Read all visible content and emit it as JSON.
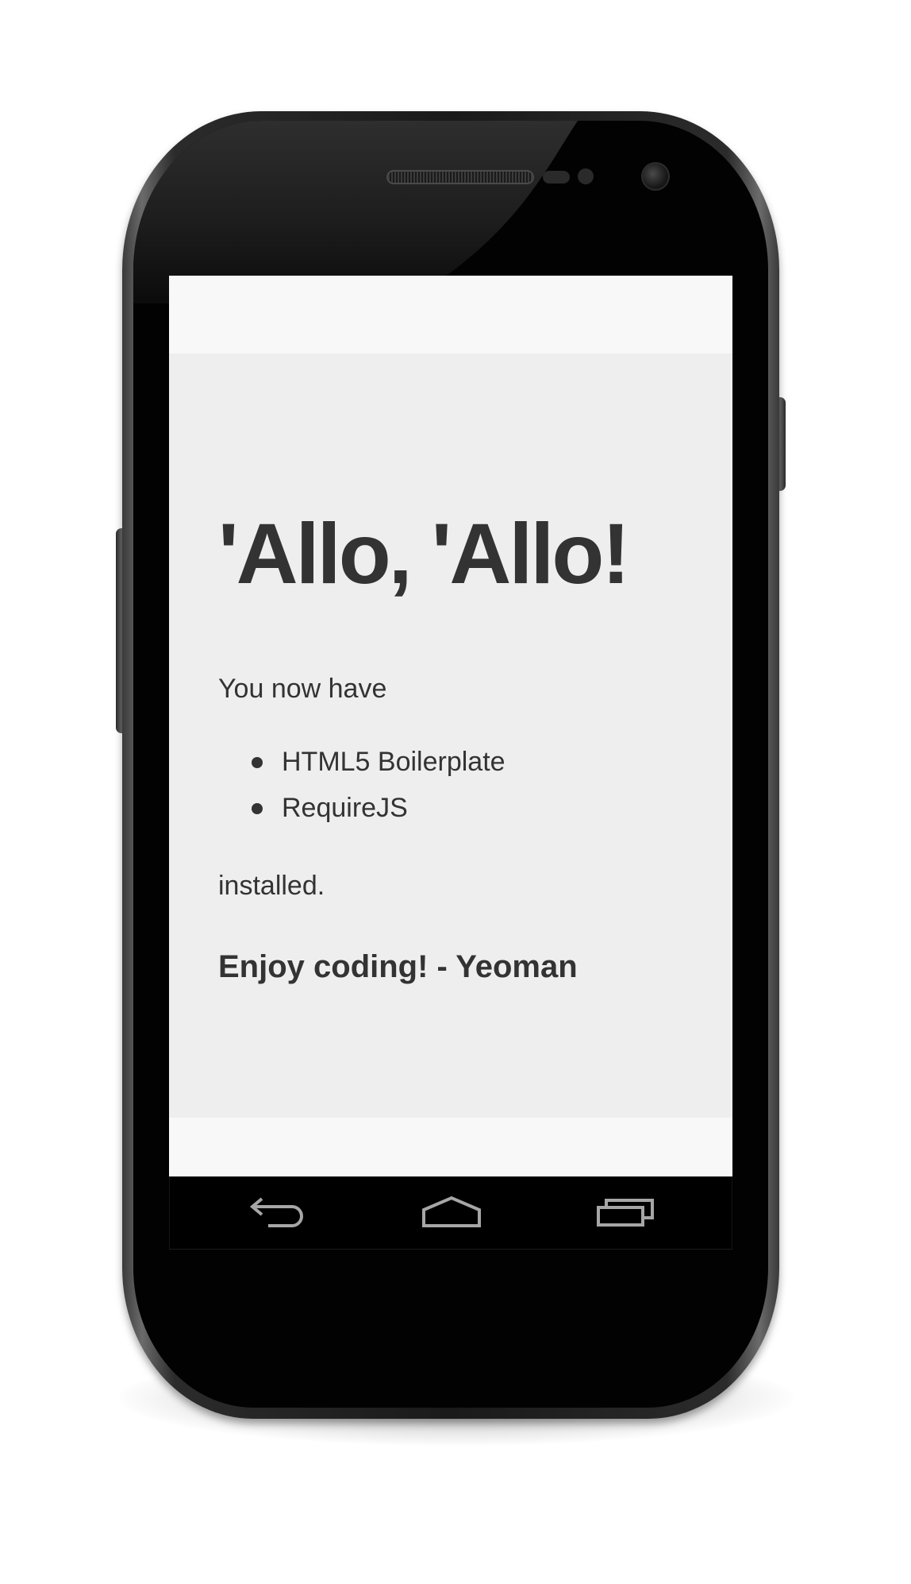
{
  "page": {
    "heading": "'Allo, 'Allo!",
    "intro": "You now have",
    "items": [
      "HTML5 Boilerplate",
      "RequireJS"
    ],
    "installed": "installed.",
    "signoff": "Enjoy coding! - Yeoman"
  },
  "navbar": {
    "back_icon": "back-icon",
    "home_icon": "home-icon",
    "recents_icon": "recent-apps-icon"
  },
  "colors": {
    "content_background": "#eeeeee",
    "screen_background": "#f8f8f8",
    "text": "#333333",
    "navbar": "#000000",
    "nav_icon": "#a6a6a6"
  }
}
